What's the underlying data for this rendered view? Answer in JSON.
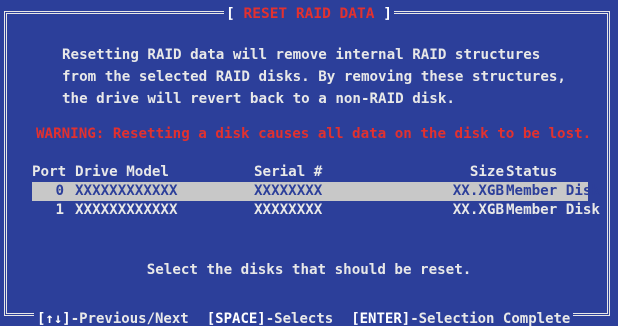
{
  "title": "RESET RAID DATA",
  "description_lines": [
    "Resetting RAID data will remove internal RAID structures",
    "from the selected RAID disks. By removing these structures,",
    "the drive will revert back to a non-RAID disk."
  ],
  "warning": "WARNING: Resetting a disk causes all data on the disk to be lost.",
  "table": {
    "headers": {
      "port": "Port",
      "model": "Drive Model",
      "serial": "Serial #",
      "size": "Size",
      "status": "Status"
    },
    "rows": [
      {
        "port": "0",
        "model": "XXXXXXXXXXXX",
        "serial": "XXXXXXXX",
        "size": "XX.XGB",
        "status": "Member Disk",
        "selected": true
      },
      {
        "port": "1",
        "model": "XXXXXXXXXXXX",
        "serial": "XXXXXXXX",
        "size": "XX.XGB",
        "status": "Member Disk",
        "selected": false
      }
    ]
  },
  "prompt": "Select the disks that should be reset.",
  "footer": {
    "nav_key": "[↑↓]",
    "nav_label": "-Previous/Next",
    "select_key": "[SPACE]",
    "select_label": "-Selects",
    "complete_key": "[ENTER]",
    "complete_label": "-Selection Complete"
  },
  "colors": {
    "background": "#2c3f9a",
    "text": "#e8e8e8",
    "title": "#e2312f",
    "warning": "#e2312f",
    "selection_bg": "#c8c8c8"
  }
}
